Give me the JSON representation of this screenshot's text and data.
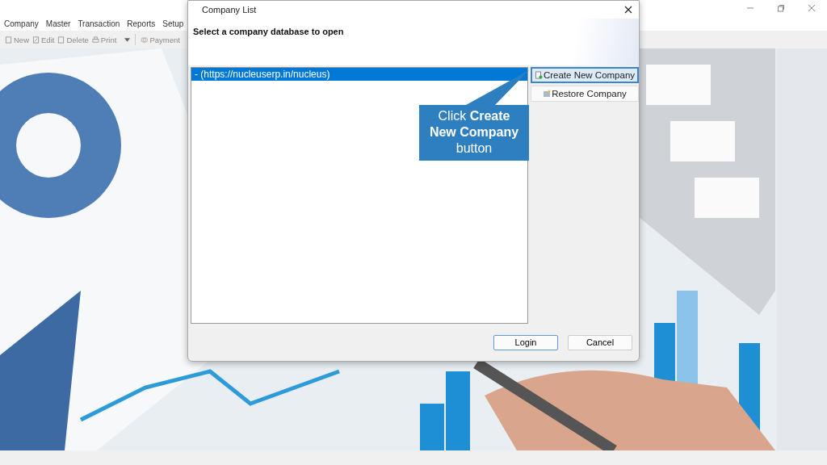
{
  "menu": [
    "Company",
    "Master",
    "Transaction",
    "Reports",
    "Setup"
  ],
  "toolbar": [
    {
      "label": "New",
      "kind": "new"
    },
    {
      "label": "Edit",
      "kind": "edit"
    },
    {
      "label": "Delete",
      "kind": "delete"
    },
    {
      "label": "Print",
      "kind": "print"
    },
    {
      "kind": "caret"
    },
    {
      "label": "Payment",
      "kind": "payment"
    }
  ],
  "background": {
    "kind": "picture"
  },
  "dialog": {
    "title": "Company List",
    "heading": "Select a company database to open",
    "companies": [
      {
        "label": "- (https://nucleuserp.in/nucleus)",
        "selected": true
      }
    ],
    "side_buttons": [
      {
        "label": "Create New Company",
        "kind": "create",
        "focused": true
      },
      {
        "label": "Restore Company",
        "kind": "restore",
        "focused": false
      }
    ],
    "buttons": [
      {
        "label": "Login",
        "default": true
      },
      {
        "label": "Cancel",
        "default": false
      }
    ]
  },
  "callout": "Click  **Create New Company** button"
}
